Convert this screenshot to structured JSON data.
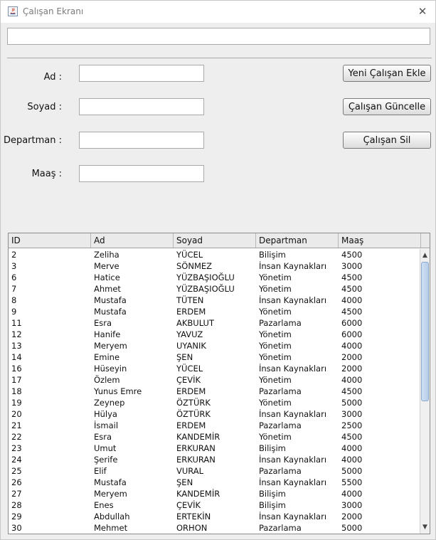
{
  "window": {
    "title": "Çalışan Ekranı",
    "close_glyph": "✕"
  },
  "top_field": {
    "value": ""
  },
  "form": {
    "fields": [
      {
        "label": "Ad :",
        "value": ""
      },
      {
        "label": "Soyad :",
        "value": ""
      },
      {
        "label": "Departman :",
        "value": ""
      },
      {
        "label": "Maaş :",
        "value": ""
      }
    ]
  },
  "buttons": {
    "add": "Yeni Çalışan Ekle",
    "update": "Çalışan Güncelle",
    "delete": "Çalışan Sil"
  },
  "table": {
    "columns": [
      "ID",
      "Ad",
      "Soyad",
      "Departman",
      "Maaş"
    ],
    "rows": [
      [
        "2",
        "Zeliha",
        "YÜCEL",
        "Bilişim",
        "4500"
      ],
      [
        "3",
        "Merve",
        "SÖNMEZ",
        "İnsan Kaynakları",
        "3000"
      ],
      [
        "6",
        "Hatice",
        "YÜZBAŞIOĞLU",
        "Yönetim",
        "4500"
      ],
      [
        "7",
        "Ahmet",
        "YÜZBAŞIOĞLU",
        "Yönetim",
        "4500"
      ],
      [
        "8",
        "Mustafa",
        "TÜTEN",
        "İnsan Kaynakları",
        "4000"
      ],
      [
        "9",
        "Mustafa",
        "ERDEM",
        "Yönetim",
        "4500"
      ],
      [
        "11",
        "Esra",
        "AKBULUT",
        "Pazarlama",
        "6000"
      ],
      [
        "12",
        "Hanife",
        "YAVUZ",
        "Yönetim",
        "6000"
      ],
      [
        "13",
        "Meryem",
        "UYANIK",
        "Yönetim",
        "4000"
      ],
      [
        "14",
        "Emine",
        "ŞEN",
        "Yönetim",
        "2000"
      ],
      [
        "16",
        "Hüseyin",
        "YÜCEL",
        "İnsan Kaynakları",
        "2000"
      ],
      [
        "17",
        "Özlem",
        "ÇEVİK",
        "Yönetim",
        "4000"
      ],
      [
        "18",
        "Yunus Emre",
        "ERDEM",
        "Pazarlama",
        "4500"
      ],
      [
        "19",
        "Zeynep",
        "ÖZTÜRK",
        "Yönetim",
        "5000"
      ],
      [
        "20",
        "Hülya",
        "ÖZTÜRK",
        "İnsan Kaynakları",
        "3000"
      ],
      [
        "21",
        "İsmail",
        "ERDEM",
        "Pazarlama",
        "2500"
      ],
      [
        "22",
        "Esra",
        "KANDEMİR",
        "Yönetim",
        "4500"
      ],
      [
        "23",
        "Umut",
        "ERKURAN",
        "Bilişim",
        "4000"
      ],
      [
        "24",
        "Şerife",
        "ERKURAN",
        "İnsan Kaynakları",
        "4000"
      ],
      [
        "25",
        "Elif",
        "VURAL",
        "Pazarlama",
        "5000"
      ],
      [
        "26",
        "Mustafa",
        "ŞEN",
        "İnsan Kaynakları",
        "5500"
      ],
      [
        "27",
        "Meryem",
        "KANDEMİR",
        "Bilişim",
        "4000"
      ],
      [
        "28",
        "Enes",
        "ÇEVİK",
        "Bilişim",
        "3000"
      ],
      [
        "29",
        "Abdullah",
        "ERTEKİN",
        "İnsan Kaynakları",
        "2000"
      ],
      [
        "30",
        "Mehmet",
        "ORHON",
        "Pazarlama",
        "5000"
      ]
    ]
  },
  "scrollbar": {
    "up_glyph": "▲",
    "down_glyph": "▼"
  }
}
